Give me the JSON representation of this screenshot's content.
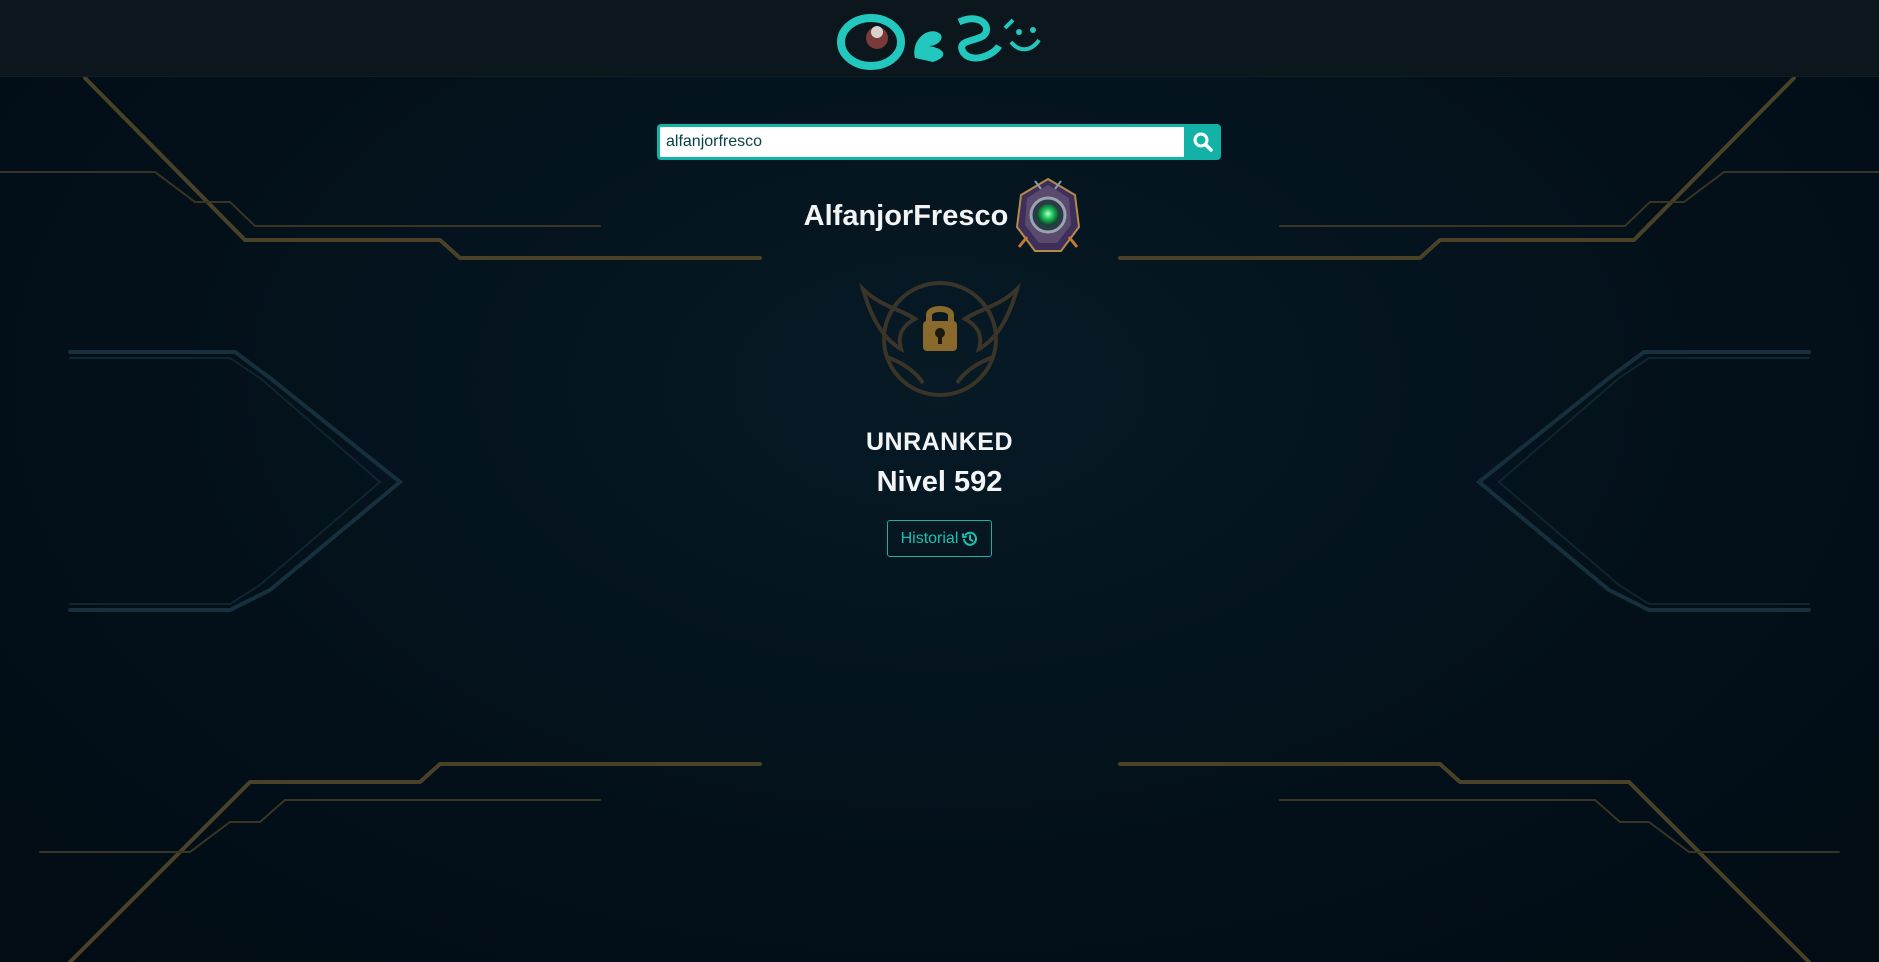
{
  "header": {
    "logo_icon": "app-logo"
  },
  "search": {
    "value": "alfanjorfresco",
    "icon": "search-icon"
  },
  "summoner": {
    "name": "AlfanjorFresco",
    "profile_icon": "summoner-profile-icon"
  },
  "ranked": {
    "emblem_icon": "unranked-lock-emblem",
    "tier": "UNRANKED",
    "level": "Nivel 592"
  },
  "history_button": {
    "label": "Historial",
    "icon": "history-icon"
  },
  "colors": {
    "accent": "#12b3a6",
    "background": "#04111a",
    "topbar": "#0b171d",
    "gold": "#8a6a2c",
    "text": "#f2f4f5"
  }
}
